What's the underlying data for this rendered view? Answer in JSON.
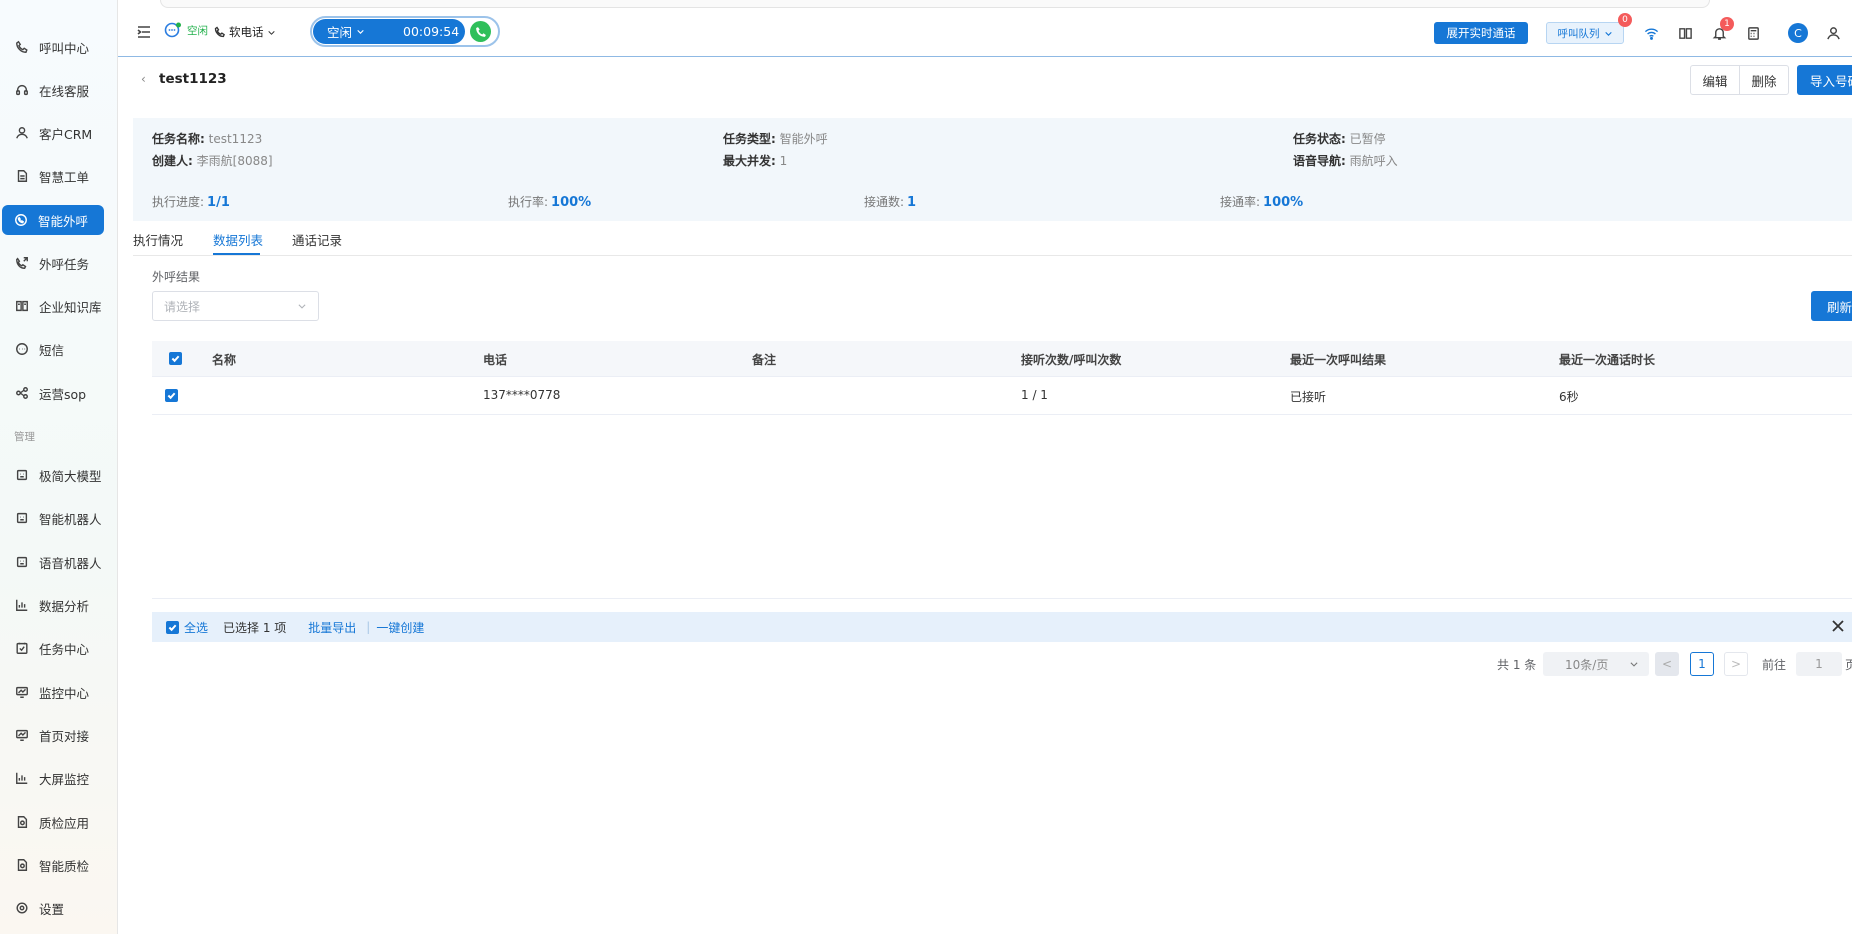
{
  "sidebar": {
    "items": [
      {
        "label": "呼叫中心",
        "icon": "phone-icon"
      },
      {
        "label": "在线客服",
        "icon": "headset-icon"
      },
      {
        "label": "客户CRM",
        "icon": "user-icon"
      },
      {
        "label": "智慧工单",
        "icon": "document-icon"
      },
      {
        "label": "智能外呼",
        "icon": "whatsapp-phone-icon"
      },
      {
        "label": "外呼任务",
        "icon": "phone-forward-icon"
      },
      {
        "label": "企业知识库",
        "icon": "book-icon"
      },
      {
        "label": "短信",
        "icon": "sms-icon"
      },
      {
        "label": "运营sop",
        "icon": "flow-icon"
      },
      {
        "label": "极简大模型",
        "icon": "robot-icon"
      },
      {
        "label": "智能机器人",
        "icon": "robot-icon"
      },
      {
        "label": "语音机器人",
        "icon": "robot-icon"
      },
      {
        "label": "数据分析",
        "icon": "chart-icon"
      },
      {
        "label": "任务中心",
        "icon": "task-icon"
      },
      {
        "label": "监控中心",
        "icon": "monitor-icon"
      },
      {
        "label": "首页对接",
        "icon": "monitor-icon"
      },
      {
        "label": "大屏监控",
        "icon": "chart-icon"
      },
      {
        "label": "质检应用",
        "icon": "inspect-icon"
      },
      {
        "label": "智能质检",
        "icon": "inspect-icon"
      },
      {
        "label": "设置",
        "icon": "gear-icon"
      }
    ],
    "group_label": "管理",
    "active_index": 4
  },
  "topbar": {
    "chat_status": "空闲",
    "softphone_label": "软电话",
    "agent_state": "空闲",
    "timer": "00:09:54",
    "realtime_button": "展开实时通话",
    "queue_button": "呼叫队列",
    "queue_badge": "0",
    "notify_badge": "1",
    "avatar_letter": "C"
  },
  "page": {
    "back_icon": "‹",
    "title": "test1123",
    "edit_button": "编辑",
    "delete_button": "删除",
    "import_button": "导入号码"
  },
  "info": {
    "task_name_label": "任务名称:",
    "task_name": "test1123",
    "creator_label": "创建人:",
    "creator": "李雨航[8088]",
    "task_type_label": "任务类型:",
    "task_type": "智能外呼",
    "max_concurrency_label": "最大并发:",
    "max_concurrency": "1",
    "task_status_label": "任务状态:",
    "task_status": "已暂停",
    "voice_nav_label": "语音导航:",
    "voice_nav": "雨航呼入",
    "stats": [
      {
        "label": "执行进度:",
        "value": "1/1"
      },
      {
        "label": "执行率:",
        "value": "100%"
      },
      {
        "label": "接通数:",
        "value": "1"
      },
      {
        "label": "接通率:",
        "value": "100%"
      }
    ]
  },
  "tabs": [
    {
      "label": "执行情况"
    },
    {
      "label": "数据列表"
    },
    {
      "label": "通话记录"
    }
  ],
  "filter": {
    "label": "外呼结果",
    "placeholder": "请选择",
    "refresh_button": "刷新"
  },
  "table": {
    "columns": [
      "名称",
      "电话",
      "备注",
      "接听次数/呼叫次数",
      "最近一次呼叫结果",
      "最近一次通话时长"
    ],
    "rows": [
      {
        "name": "",
        "phone": "137****0778",
        "note": "",
        "answer_ratio": "1 / 1",
        "last_result": "已接听",
        "last_duration": "6秒"
      }
    ]
  },
  "selection": {
    "select_all": "全选",
    "selected_text": "已选择 1 项",
    "batch_export": "批量导出",
    "separator": "|",
    "one_click_create": "一键创建"
  },
  "pagination": {
    "total": "共 1 条",
    "page_size": "10条/页",
    "prev": "<",
    "current_page": "1",
    "next": ">",
    "goto_label": "前往",
    "goto_value": "1",
    "goto_unit": "页"
  }
}
